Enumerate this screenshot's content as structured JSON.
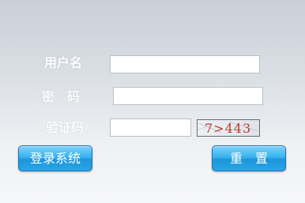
{
  "form": {
    "username_label": "用户名",
    "password_label": "密　码",
    "captcha_label": "验证码",
    "username_value": "",
    "password_value": "",
    "captcha_value": ""
  },
  "captcha": {
    "text": "7>443",
    "text_color": "#c0392b"
  },
  "buttons": {
    "login_label": "登录系统",
    "reset_label": "重　置"
  },
  "colors": {
    "button_top": "#7fd3fb",
    "button_bottom": "#1d95d9",
    "label_text": "#ffffff"
  }
}
